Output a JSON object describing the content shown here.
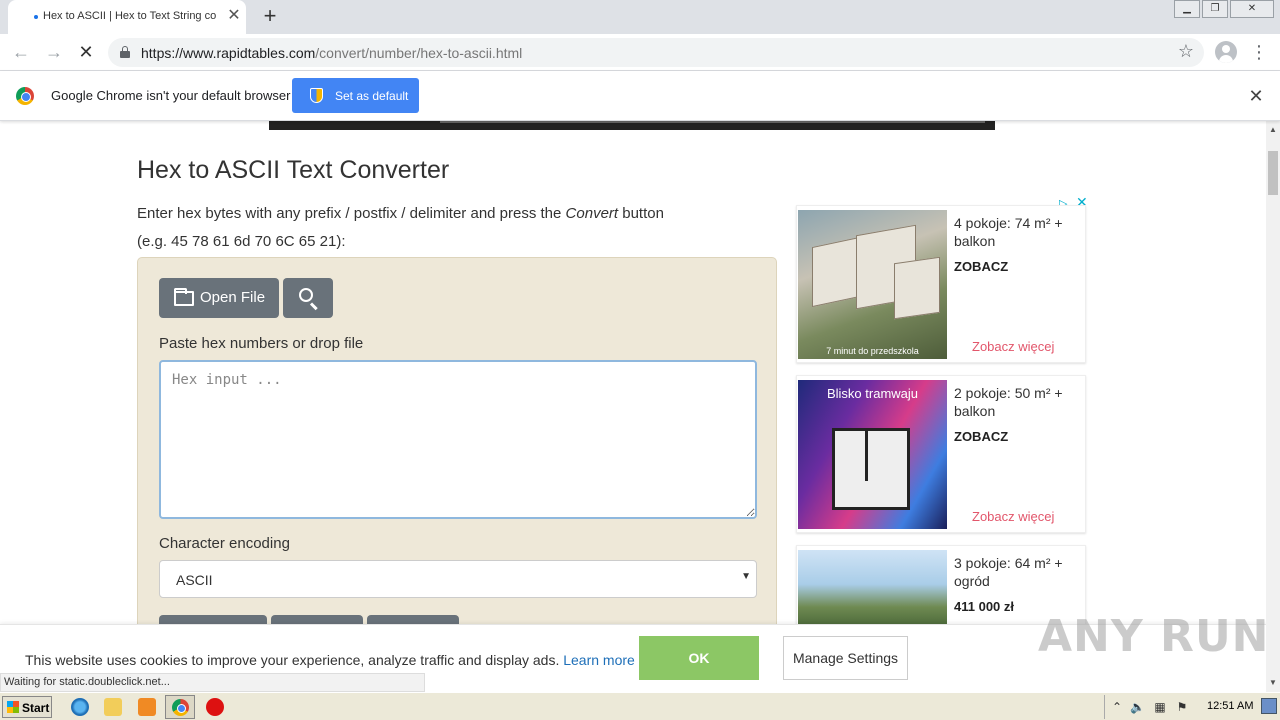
{
  "browser": {
    "tab_title": "Hex to ASCII | Hex to Text String co",
    "url_domain": "https://www.rapidtables.com",
    "url_path": "/convert/number/hex-to-ascii.html",
    "status_text": "Waiting for static.doubleclick.net..."
  },
  "infobar": {
    "message": "Google Chrome isn't your default browser",
    "button": "Set as default"
  },
  "page": {
    "title": "Hex to ASCII Text Converter",
    "intro_before": "Enter hex bytes with any prefix / postfix / delimiter and press the ",
    "intro_em": "Convert",
    "intro_after": " button",
    "example": "(e.g. 45 78 61 6d 70 6C 65 21):",
    "open_file": "Open File",
    "paste_label": "Paste hex numbers or drop file",
    "input_placeholder": "Hex input ...",
    "encoding_label": "Character encoding",
    "encoding_value": "ASCII"
  },
  "ads": [
    {
      "title": "4 pokoje: 74 m² + balkon",
      "cta": "ZOBACZ",
      "more": "Zobacz więcej",
      "image_caption": "7 minut do przedszkola"
    },
    {
      "title": "2 pokoje: 50 m² + balkon",
      "cta": "ZOBACZ",
      "more": "Zobacz więcej",
      "image_caption": "Blisko tramwaju"
    },
    {
      "title": "3 pokoje: 64 m² + ogród",
      "cta": "411 000 zł"
    }
  ],
  "cookie": {
    "text": "This website uses cookies to improve your experience, analyze traffic and display ads. ",
    "link": "Learn more",
    "ok": "OK",
    "manage": "Manage Settings"
  },
  "watermark": "ANY RUN",
  "taskbar": {
    "start": "Start",
    "clock": "12:51 AM"
  }
}
